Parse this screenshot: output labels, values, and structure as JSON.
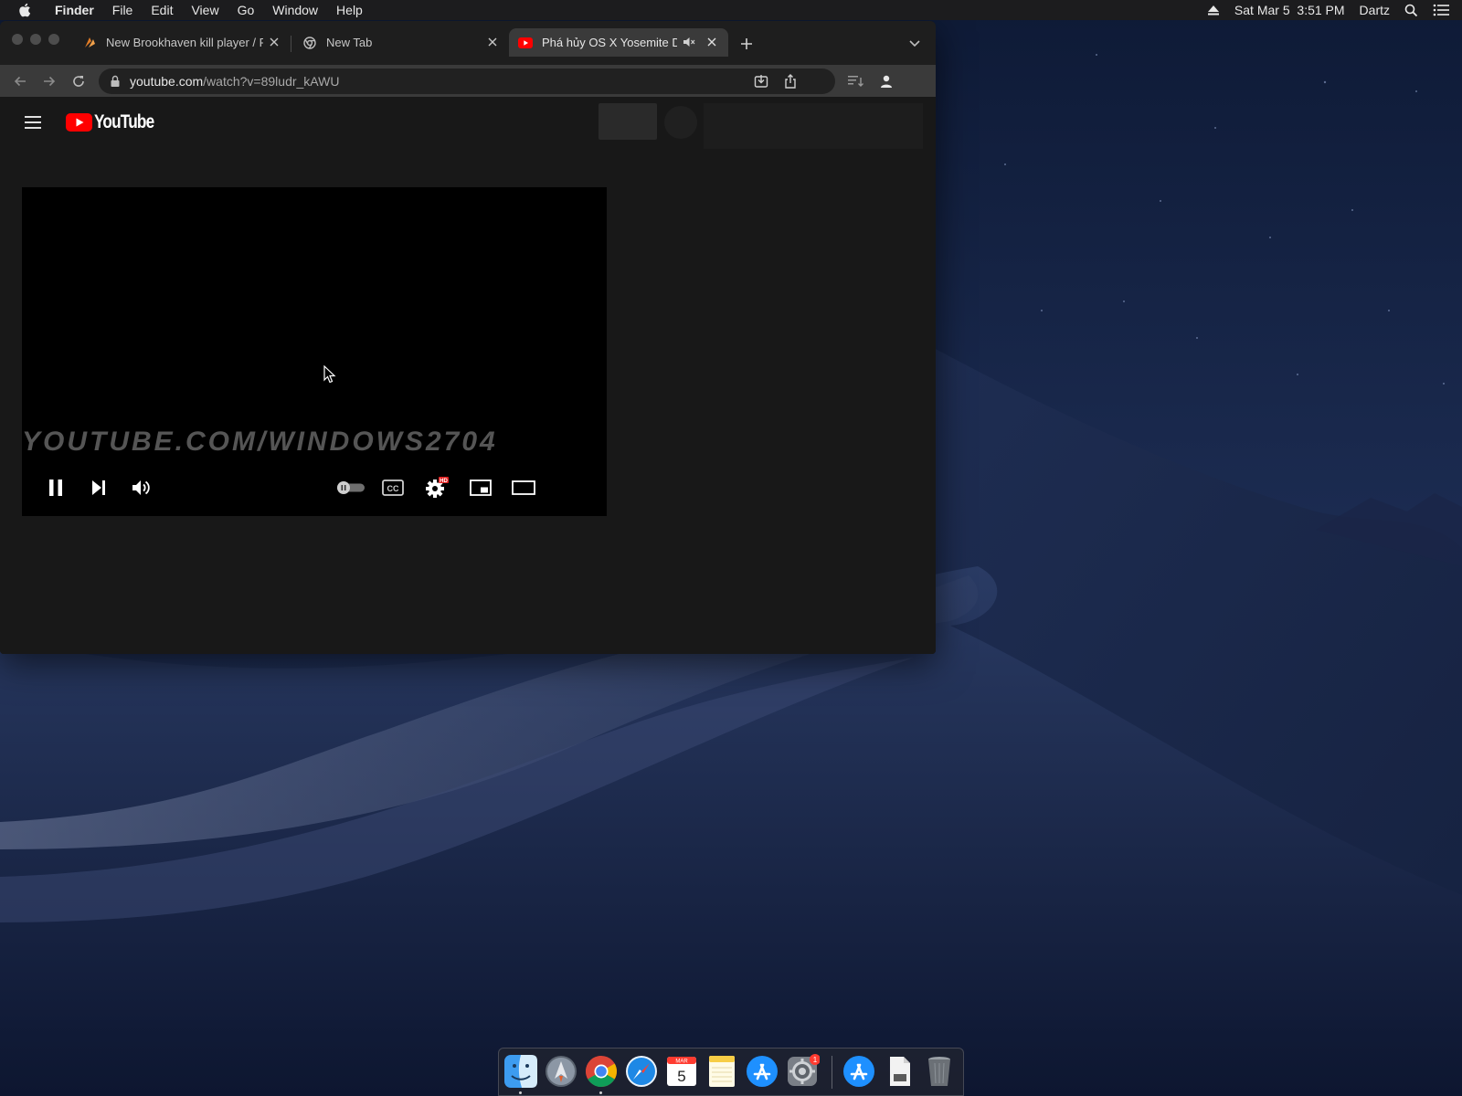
{
  "menubar": {
    "app_name": "Finder",
    "menus": [
      "File",
      "Edit",
      "View",
      "Go",
      "Window",
      "Help"
    ],
    "date": "Sat Mar 5",
    "time": "3:51 PM",
    "user": "Dartz"
  },
  "browser": {
    "tabs": [
      {
        "title": "New Brookhaven kill player / Fa",
        "icon": "roblox-favicon-icon",
        "active": false
      },
      {
        "title": "New Tab",
        "icon": "chrome-favicon-icon",
        "active": false
      },
      {
        "title": "Phá hủy OS X Yosemite DP",
        "icon": "youtube-favicon-icon",
        "active": true,
        "audio": "muted-speaker-icon"
      }
    ],
    "address_bar": {
      "domain": "youtube.com",
      "path": "/watch?v=89ludr_kAWU"
    }
  },
  "youtube": {
    "logo_text": "YouTube",
    "watermark": "YOUTUBE.COM/WINDOWS2704",
    "controls": {
      "settings_badge": "HD",
      "state": "playing",
      "autoplay": "off"
    }
  },
  "dock": {
    "apps": [
      "Finder",
      "Launchpad",
      "Google Chrome",
      "Safari",
      "Calendar",
      "Notes",
      "App Store",
      "System Preferences",
      "App Store",
      "Document",
      "Trash"
    ],
    "calendar_month": "MAR",
    "calendar_day": "5",
    "system_prefs_badge": "1"
  },
  "colors": {
    "accent_red": "#ff0000",
    "menubar_bg": "#1c1c1e",
    "browser_bg": "#181818"
  }
}
